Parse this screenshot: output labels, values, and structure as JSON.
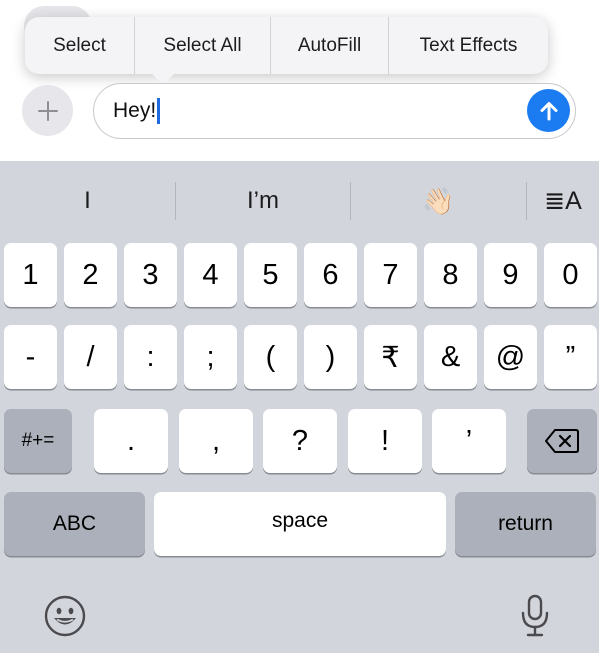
{
  "context_menu": {
    "items": [
      "Select",
      "Select All",
      "AutoFill",
      "Text Effects"
    ]
  },
  "compose": {
    "message_text": "Hey!",
    "plus_icon": "plus-icon",
    "send_icon": "arrow-up-icon"
  },
  "suggestions": [
    "I",
    "I’m",
    "👋🏻",
    "≣A"
  ],
  "keyboard": {
    "row1": [
      "1",
      "2",
      "3",
      "4",
      "5",
      "6",
      "7",
      "8",
      "9",
      "0"
    ],
    "row2": [
      "-",
      "/",
      ":",
      ";",
      "(",
      ")",
      "₹",
      "&",
      "@",
      "”"
    ],
    "row3_left": "#+=",
    "row3": [
      ".",
      ",",
      "?",
      "!",
      "’"
    ],
    "row3_right_icon": "backspace-icon",
    "row4": {
      "abc": "ABC",
      "space": "space",
      "return": "return"
    },
    "bottom_icons": {
      "left": "emoji-icon",
      "right": "microphone-icon"
    }
  },
  "colors": {
    "keyboard_bg": "#d3d5dc",
    "key": "#ffffff",
    "dark_key": "#abb0bb",
    "send": "#1b7cf2",
    "caret": "#1f6ae0"
  }
}
